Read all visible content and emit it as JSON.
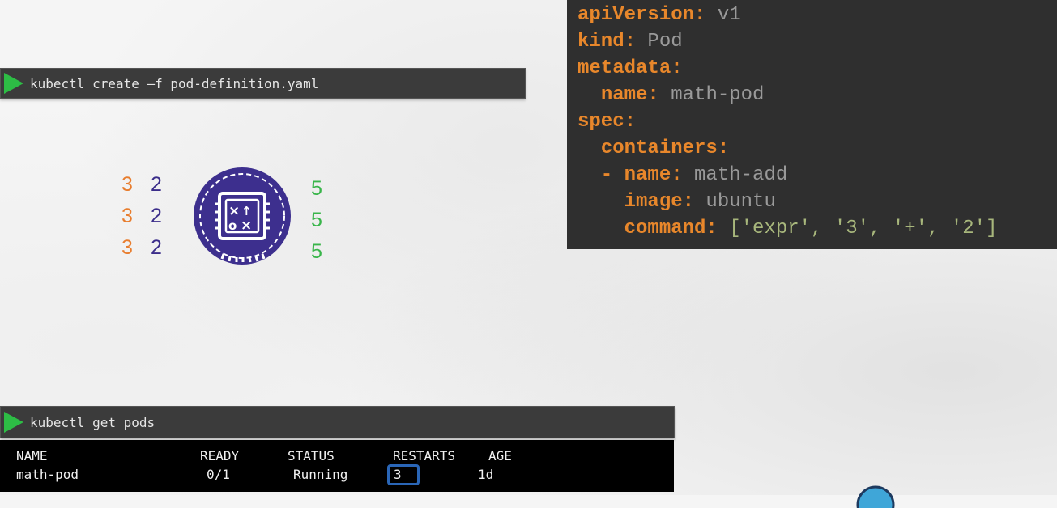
{
  "terminal_create": {
    "command": "kubectl create –f pod-definition.yaml"
  },
  "yaml": {
    "lines": [
      {
        "key": "apiVersion:",
        "value": " v1"
      },
      {
        "key": "kind:",
        "value": " Pod"
      },
      {
        "key": "metadata:",
        "value": ""
      },
      {
        "indent": "  ",
        "key": "name:",
        "value": " math-pod"
      },
      {
        "key": "spec:",
        "value": ""
      },
      {
        "indent": "  ",
        "key": "containers:",
        "value": ""
      },
      {
        "indent": "  - ",
        "key": "name:",
        "value": " math-add"
      },
      {
        "indent": "    ",
        "key": "image:",
        "value": " ubuntu"
      },
      {
        "indent": "    ",
        "key": "command:",
        "value": " ['expr', '3', '+', '2']"
      }
    ]
  },
  "math": {
    "rows": [
      {
        "a": "3",
        "b": "2",
        "result": "5"
      },
      {
        "a": "3",
        "b": "2",
        "result": "5"
      },
      {
        "a": "3",
        "b": "2",
        "result": "5"
      }
    ],
    "icon": "math-pod-icon"
  },
  "terminal_get": {
    "command": "kubectl get pods"
  },
  "pods_table": {
    "headers": [
      "NAME",
      "READY",
      "STATUS",
      "RESTARTS",
      "AGE"
    ],
    "rows": [
      [
        "math-pod",
        "0/1",
        "Running",
        "3",
        "1d"
      ]
    ],
    "highlight_color": "#2a66b7"
  },
  "colors": {
    "yaml_key": "#e8872b",
    "yaml_value": "#9a9a9a",
    "operand_a": "#e87d2e",
    "operand_b": "#3b2d8a",
    "result": "#39b54a",
    "play": "#2dbd45"
  }
}
